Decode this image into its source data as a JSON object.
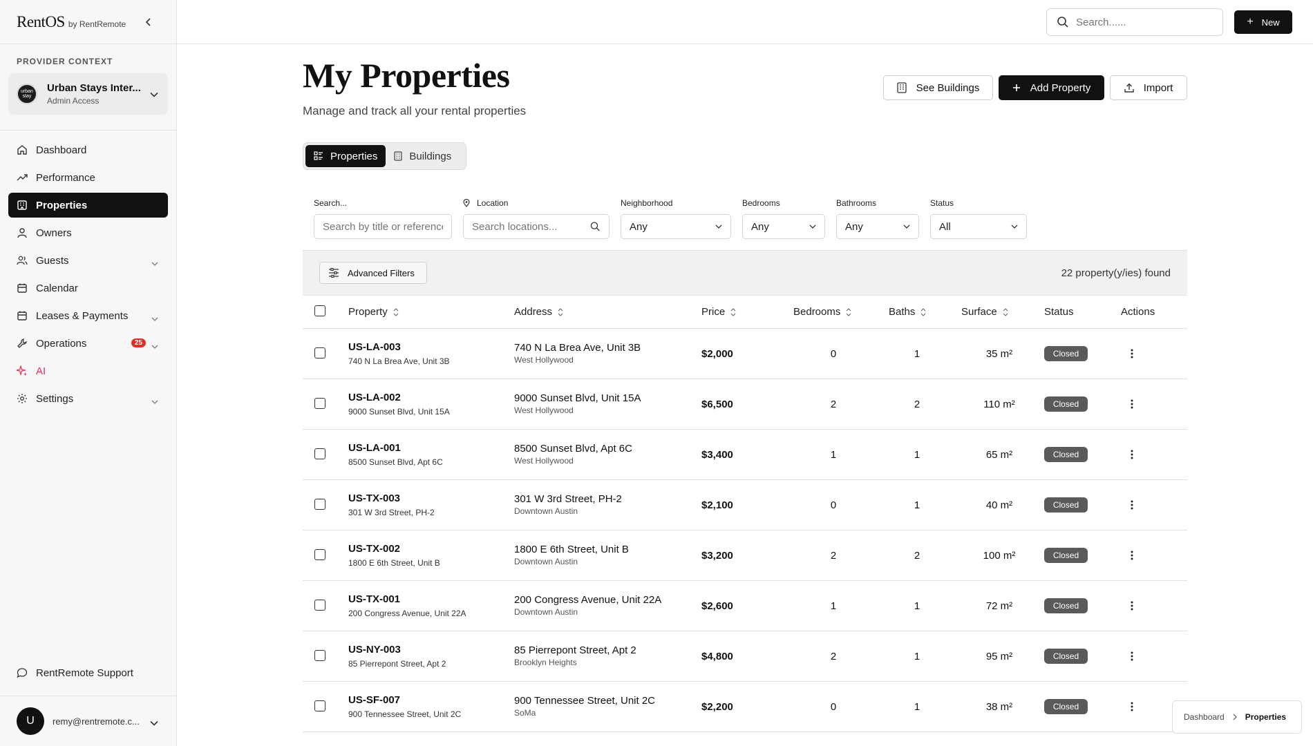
{
  "app": {
    "logo_main": "RentOS",
    "logo_sub": "by RentRemote"
  },
  "sidebar": {
    "provider_label": "PROVIDER CONTEXT",
    "provider_name": "Urban Stays Inter...",
    "provider_role": "Admin Access",
    "provider_avatar_text": "urban stay",
    "items": [
      {
        "label": "Dashboard",
        "icon": "home-icon"
      },
      {
        "label": "Performance",
        "icon": "trend-icon"
      },
      {
        "label": "Properties",
        "icon": "building-icon",
        "active": true
      },
      {
        "label": "Owners",
        "icon": "person-icon"
      },
      {
        "label": "Guests",
        "icon": "people-icon",
        "chevron": true
      },
      {
        "label": "Calendar",
        "icon": "calendar-icon"
      },
      {
        "label": "Leases & Payments",
        "icon": "wallet-icon",
        "chevron": true
      },
      {
        "label": "Operations",
        "icon": "wrench-icon",
        "chevron": true,
        "badge": "25"
      },
      {
        "label": "AI",
        "icon": "sparkle-icon"
      },
      {
        "label": "Settings",
        "icon": "gear-icon",
        "chevron": true
      }
    ],
    "support_label": "RentRemote Support",
    "user_initial": "U",
    "user_email": "remy@rentremote.c..."
  },
  "topbar": {
    "search_placeholder": "Search......",
    "new_label": "New"
  },
  "header": {
    "title": "My Properties",
    "subtitle": "Manage and track all your rental properties",
    "see_buildings_label": "See Buildings",
    "add_property_label": "Add Property",
    "import_label": "Import"
  },
  "tabs": {
    "properties": "Properties",
    "buildings": "Buildings"
  },
  "filters": {
    "search_label": "Search...",
    "search_placeholder": "Search by title or reference",
    "location_label": "Location",
    "location_placeholder": "Search locations...",
    "neighborhood_label": "Neighborhood",
    "neighborhood_value": "Any",
    "bedrooms_label": "Bedrooms",
    "bedrooms_value": "Any",
    "bathrooms_label": "Bathrooms",
    "bathrooms_value": "Any",
    "status_label": "Status",
    "status_value": "All"
  },
  "results": {
    "advanced_filters_label": "Advanced Filters",
    "found_text": "22 property(y/ies) found"
  },
  "table": {
    "columns": {
      "property": "Property",
      "address": "Address",
      "price": "Price",
      "bedrooms": "Bedrooms",
      "baths": "Baths",
      "surface": "Surface",
      "status": "Status",
      "actions": "Actions"
    },
    "rows": [
      {
        "code": "US-LA-003",
        "prop_addr": "740 N La Brea Ave, Unit 3B",
        "address": "740 N La Brea Ave, Unit 3B",
        "area": "West Hollywood",
        "price": "$2,000",
        "bedrooms": "0",
        "baths": "1",
        "surface": "35 m²",
        "status": "Closed"
      },
      {
        "code": "US-LA-002",
        "prop_addr": "9000 Sunset Blvd, Unit 15A",
        "address": "9000 Sunset Blvd, Unit 15A",
        "area": "West Hollywood",
        "price": "$6,500",
        "bedrooms": "2",
        "baths": "2",
        "surface": "110 m²",
        "status": "Closed"
      },
      {
        "code": "US-LA-001",
        "prop_addr": "8500 Sunset Blvd, Apt 6C",
        "address": "8500 Sunset Blvd, Apt 6C",
        "area": "West Hollywood",
        "price": "$3,400",
        "bedrooms": "1",
        "baths": "1",
        "surface": "65 m²",
        "status": "Closed"
      },
      {
        "code": "US-TX-003",
        "prop_addr": "301 W 3rd Street, PH-2",
        "address": "301 W 3rd Street, PH-2",
        "area": "Downtown Austin",
        "price": "$2,100",
        "bedrooms": "0",
        "baths": "1",
        "surface": "40 m²",
        "status": "Closed"
      },
      {
        "code": "US-TX-002",
        "prop_addr": "1800 E 6th Street, Unit B",
        "address": "1800 E 6th Street, Unit B",
        "area": "Downtown Austin",
        "price": "$3,200",
        "bedrooms": "2",
        "baths": "2",
        "surface": "100 m²",
        "status": "Closed"
      },
      {
        "code": "US-TX-001",
        "prop_addr": "200 Congress Avenue, Unit 22A",
        "address": "200 Congress Avenue, Unit 22A",
        "area": "Downtown Austin",
        "price": "$2,600",
        "bedrooms": "1",
        "baths": "1",
        "surface": "72 m²",
        "status": "Closed"
      },
      {
        "code": "US-NY-003",
        "prop_addr": "85 Pierrepont Street, Apt 2",
        "address": "85 Pierrepont Street, Apt 2",
        "area": "Brooklyn Heights",
        "price": "$4,800",
        "bedrooms": "2",
        "baths": "1",
        "surface": "95 m²",
        "status": "Closed"
      },
      {
        "code": "US-SF-007",
        "prop_addr": "900 Tennessee Street, Unit 2C",
        "address": "900 Tennessee Street, Unit 2C",
        "area": "SoMa",
        "price": "$2,200",
        "bedrooms": "0",
        "baths": "1",
        "surface": "38 m²",
        "status": "Closed"
      }
    ]
  },
  "breadcrumb": {
    "parent": "Dashboard",
    "current": "Properties"
  },
  "colors": {
    "accent": "#111111",
    "status_closed": "#5a5a5a",
    "badge": "#d93025",
    "ai": "#e0305a"
  }
}
